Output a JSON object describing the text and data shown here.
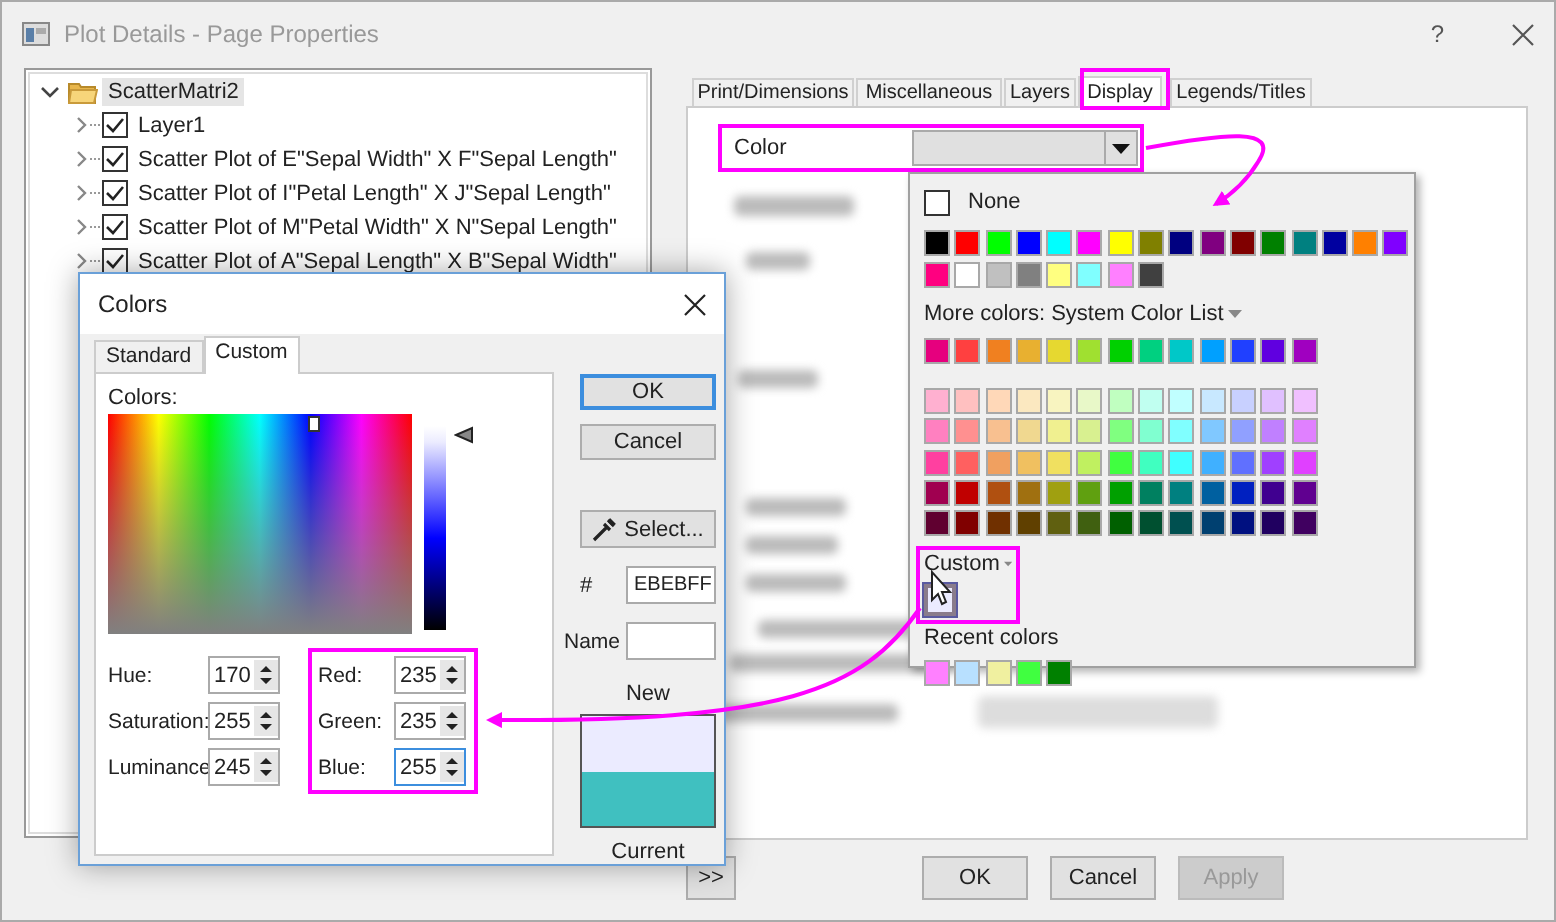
{
  "window": {
    "title": "Plot Details - Page Properties",
    "help": "?"
  },
  "tree": {
    "label": "ScatterMatri2",
    "expanded": true,
    "selected": true,
    "children": [
      {
        "label": "Layer1",
        "checked": true,
        "selected": false
      },
      {
        "label": "Scatter Plot of E\"Sepal Width\" X F\"Sepal Length\"",
        "checked": true,
        "selected": false
      },
      {
        "label": "Scatter Plot of I\"Petal Length\" X J\"Sepal Length\"",
        "checked": true,
        "selected": false
      },
      {
        "label": "Scatter Plot of M\"Petal Width\" X N\"Sepal Length\"",
        "checked": true,
        "selected": false
      },
      {
        "label": "Scatter Plot of A\"Sepal Length\" X B\"Sepal Width\"",
        "checked": true,
        "selected": false
      }
    ]
  },
  "tabs": [
    {
      "label": "Print/Dimensions",
      "selected": false
    },
    {
      "label": "Miscellaneous",
      "selected": false
    },
    {
      "label": "Layers",
      "selected": false
    },
    {
      "label": "Display",
      "selected": true
    },
    {
      "label": "Legends/Titles",
      "selected": false
    }
  ],
  "display": {
    "color_label": "Color"
  },
  "color_popup": {
    "none": {
      "label": "None",
      "checked": false
    },
    "basic_colors": [
      {
        "color": "#000000"
      },
      {
        "color": "#ff0000"
      },
      {
        "color": "#00ff00"
      },
      {
        "color": "#0000ff"
      },
      {
        "color": "#00ffff"
      },
      {
        "color": "#ff00ff"
      },
      {
        "color": "#ffff00"
      },
      {
        "color": "#808000"
      },
      {
        "color": "#000080"
      },
      {
        "color": "#800080"
      },
      {
        "color": "#800000"
      },
      {
        "color": "#008000"
      },
      {
        "color": "#008080"
      },
      {
        "color": "#0000a0"
      },
      {
        "color": "#ff8000"
      },
      {
        "color": "#8000ff"
      },
      {
        "color": "#ff0080"
      },
      {
        "color": "#ffffff"
      },
      {
        "color": "#c0c0c0"
      },
      {
        "color": "#808080"
      },
      {
        "color": "#ffff80"
      },
      {
        "color": "#80ffff"
      },
      {
        "color": "#ff80ff"
      },
      {
        "color": "#404040"
      }
    ],
    "more_colors_label": "More colors: System Color List",
    "system_colors": [
      {
        "color": "#e6007e"
      },
      {
        "color": "#ff4040"
      },
      {
        "color": "#f08020"
      },
      {
        "color": "#e8b030"
      },
      {
        "color": "#e6d830"
      },
      {
        "color": "#a0e030"
      },
      {
        "color": "#00d000"
      },
      {
        "color": "#00d080"
      },
      {
        "color": "#00c8c8"
      },
      {
        "color": "#00a0ff"
      },
      {
        "color": "#2040ff"
      },
      {
        "color": "#6000e0"
      },
      {
        "color": "#a000c0"
      }
    ],
    "palette": [
      {
        "color": "#ffb0d0"
      },
      {
        "color": "#ffc0c0"
      },
      {
        "color": "#ffd8b8"
      },
      {
        "color": "#fbe8c0"
      },
      {
        "color": "#f8f4c0"
      },
      {
        "color": "#e8f8c8"
      },
      {
        "color": "#c0ffc0"
      },
      {
        "color": "#c0fff0"
      },
      {
        "color": "#c0ffff"
      },
      {
        "color": "#c8e8ff"
      },
      {
        "color": "#c8d0ff"
      },
      {
        "color": "#e0c0ff"
      },
      {
        "color": "#f0c0ff"
      },
      {
        "color": "#ff80c0"
      },
      {
        "color": "#ff9090"
      },
      {
        "color": "#f8c090"
      },
      {
        "color": "#f0d890"
      },
      {
        "color": "#f0f090"
      },
      {
        "color": "#d8f090"
      },
      {
        "color": "#80ff80"
      },
      {
        "color": "#80ffd0"
      },
      {
        "color": "#80ffff"
      },
      {
        "color": "#80c8ff"
      },
      {
        "color": "#90a0ff"
      },
      {
        "color": "#c080ff"
      },
      {
        "color": "#e080ff"
      },
      {
        "color": "#ff40a0"
      },
      {
        "color": "#ff6060"
      },
      {
        "color": "#f0a060"
      },
      {
        "color": "#f0c060"
      },
      {
        "color": "#f0e060"
      },
      {
        "color": "#c0f060"
      },
      {
        "color": "#40ff40"
      },
      {
        "color": "#40ffc0"
      },
      {
        "color": "#40ffff"
      },
      {
        "color": "#40b0ff"
      },
      {
        "color": "#6070ff"
      },
      {
        "color": "#a040ff"
      },
      {
        "color": "#e040ff"
      },
      {
        "color": "#a00050"
      },
      {
        "color": "#c00000"
      },
      {
        "color": "#b05010"
      },
      {
        "color": "#a07010"
      },
      {
        "color": "#a0a010"
      },
      {
        "color": "#60a010"
      },
      {
        "color": "#00a000"
      },
      {
        "color": "#008060"
      },
      {
        "color": "#008080"
      },
      {
        "color": "#0060a0"
      },
      {
        "color": "#0020c0"
      },
      {
        "color": "#400090"
      },
      {
        "color": "#600090"
      },
      {
        "color": "#600030"
      },
      {
        "color": "#800000"
      },
      {
        "color": "#703000"
      },
      {
        "color": "#604000"
      },
      {
        "color": "#606010"
      },
      {
        "color": "#406010"
      },
      {
        "color": "#006000"
      },
      {
        "color": "#005030"
      },
      {
        "color": "#005050"
      },
      {
        "color": "#004070"
      },
      {
        "color": "#001080"
      },
      {
        "color": "#200060"
      },
      {
        "color": "#400060"
      }
    ],
    "custom_label": "Custom",
    "custom_colors": [
      {
        "color": "#ebebff",
        "selected": true
      }
    ],
    "recent_label": "Recent colors",
    "recent_colors": [
      {
        "color": "#ff80ff"
      },
      {
        "color": "#b8e0ff"
      },
      {
        "color": "#f0f0a0"
      },
      {
        "color": "#40ff40"
      },
      {
        "color": "#008000"
      }
    ]
  },
  "colors_dialog": {
    "title": "Colors",
    "tabs": [
      {
        "label": "Standard",
        "selected": false
      },
      {
        "label": "Custom",
        "selected": true
      }
    ],
    "colors_label": "Colors:",
    "luminance": {
      "level": 0.96
    },
    "hsl_fields": [
      {
        "label": "Hue:",
        "value": "170",
        "focused": false
      },
      {
        "label": "Saturation:",
        "value": "255",
        "focused": false
      },
      {
        "label": "Luminance",
        "value": "245",
        "focused": false
      }
    ],
    "rgb_fields": [
      {
        "label": "Red:",
        "value": "235",
        "focused": false
      },
      {
        "label": "Green:",
        "value": "235",
        "focused": false
      },
      {
        "label": "Blue:",
        "value": "255",
        "focused": true
      }
    ],
    "buttons": [
      {
        "label": "OK",
        "default": true
      },
      {
        "label": "Cancel",
        "default": false
      }
    ],
    "select_button": "Select...",
    "hex_label": "#",
    "hex_value": "EBEBFF",
    "name_label": "Name",
    "new_label": "New",
    "preview_colors": [
      {
        "color": "#ebebff"
      },
      {
        "color": "#40c0c0"
      }
    ],
    "current_label": "Current"
  },
  "buttons": [
    {
      "label": ">>",
      "disabled": false
    },
    {
      "label": "OK",
      "disabled": false
    },
    {
      "label": "Cancel",
      "disabled": false
    },
    {
      "label": "Apply",
      "disabled": true
    }
  ]
}
